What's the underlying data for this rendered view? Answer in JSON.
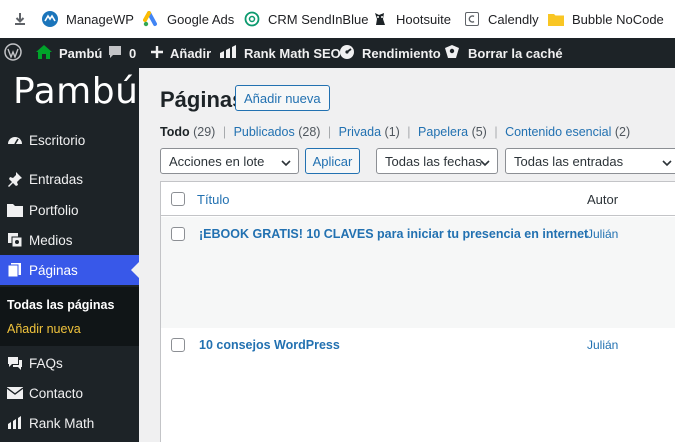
{
  "bookmarks": [
    {
      "label": "",
      "icon": "download-icon"
    },
    {
      "label": "ManageWP",
      "icon": "managewp-icon"
    },
    {
      "label": "Google Ads",
      "icon": "google-ads-icon"
    },
    {
      "label": "CRM SendInBlue",
      "icon": "sendinblue-icon"
    },
    {
      "label": "Hootsuite",
      "icon": "hootsuite-icon"
    },
    {
      "label": "Calendly",
      "icon": "calendly-icon"
    },
    {
      "label": "Bubble NoCode",
      "icon": "folder-icon"
    }
  ],
  "adminbar": {
    "site_name": "Pambú",
    "comments_count": "0",
    "new_label": "Añadir",
    "rankmath_label": "Rank Math SEO",
    "performance_label": "Rendimiento",
    "cache_label": "Borrar la caché"
  },
  "sidebar": {
    "brand": "Pambú",
    "items": [
      {
        "label": "Escritorio",
        "icon": "dashboard-icon"
      },
      {
        "label": "Entradas",
        "icon": "pin-icon"
      },
      {
        "label": "Portfolio",
        "icon": "folder-icon"
      },
      {
        "label": "Medios",
        "icon": "media-icon"
      },
      {
        "label": "Páginas",
        "icon": "pages-icon"
      },
      {
        "label": "FAQs",
        "icon": "comments-icon"
      },
      {
        "label": "Contacto",
        "icon": "mail-icon"
      },
      {
        "label": "Rank Math",
        "icon": "rankmath-icon"
      }
    ],
    "submenu": {
      "current": "Todas las páginas",
      "other": "Añadir nueva"
    }
  },
  "main": {
    "title": "Páginas",
    "add_new": "Añadir nueva",
    "views": [
      {
        "label": "Todo",
        "count": "(29)"
      },
      {
        "label": "Publicados",
        "count": "(28)"
      },
      {
        "label": "Privada",
        "count": "(1)"
      },
      {
        "label": "Papelera",
        "count": "(5)"
      },
      {
        "label": "Contenido esencial",
        "count": "(2)"
      }
    ],
    "bulk_actions": "Acciones en lote",
    "apply": "Aplicar",
    "date_filter": "Todas las fechas",
    "post_filter": "Todas las entradas",
    "columns": {
      "title": "Título",
      "author": "Autor"
    },
    "rows": [
      {
        "title": "¡EBOOK GRATIS! 10 CLAVES para iniciar tu presencia en internet",
        "author": "Julián"
      },
      {
        "title": "10 consejos WordPress",
        "author": "Julián"
      }
    ]
  },
  "colors": {
    "accent": "#3858e9",
    "link": "#2271b1",
    "adminbar": "#1d2327",
    "highlight": "#f0c33c"
  }
}
